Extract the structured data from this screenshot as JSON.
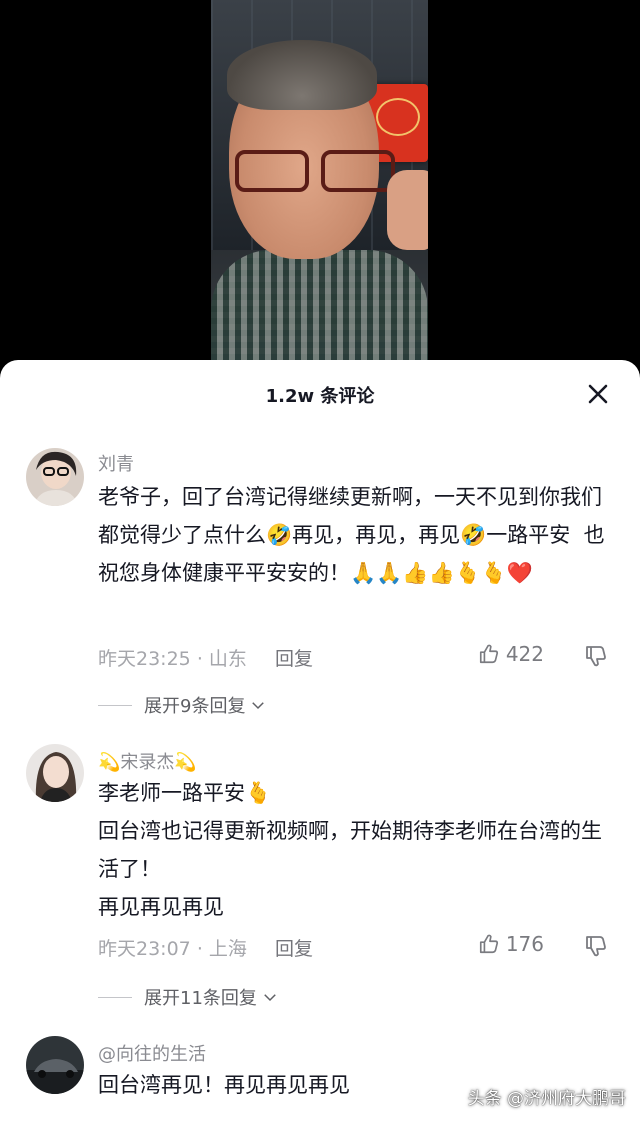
{
  "sheet": {
    "title": "1.2w 条评论"
  },
  "comments": [
    {
      "author": "刘青",
      "body": "老爷子，回了台湾记得继续更新啊，一天不见到你我们都觉得少了点什么🤣再见，再见，再见🤣一路平安  也祝您身体健康平平安安的！🙏🙏👍👍🫰🫰❤️",
      "time": "昨天23:25",
      "location": "山东",
      "reply_label": "回复",
      "likes": "422",
      "expand_label": "展开9条回复"
    },
    {
      "author": "💫宋录杰💫",
      "body": "李老师一路平安🫰\n回台湾也记得更新视频啊，开始期待李老师在台湾的生活了！\n再见再见再见",
      "time": "昨天23:07",
      "location": "上海",
      "reply_label": "回复",
      "likes": "176",
      "expand_label": "展开11条回复"
    },
    {
      "author": "@向往的生活",
      "body": "回台湾再见！再见再见再见"
    }
  ],
  "watermark": "头条 @济州府大鹏哥",
  "colors": {
    "sheet_bg": "#ffffff",
    "text_primary": "#161823",
    "text_secondary": "#8a8b91"
  }
}
